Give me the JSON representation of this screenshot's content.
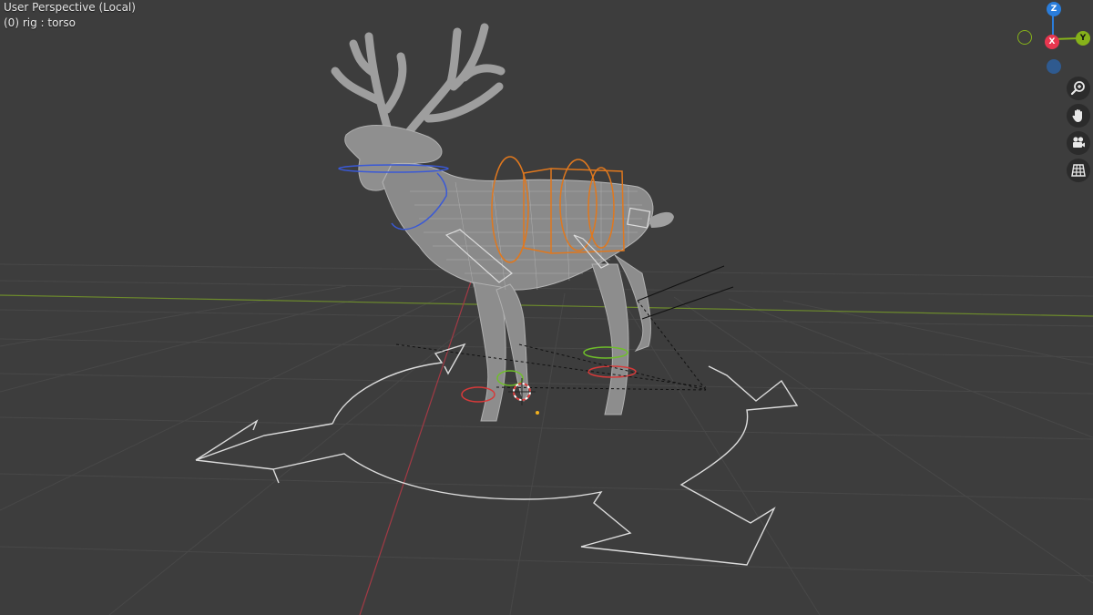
{
  "viewport": {
    "title": "User Perspective (Local)",
    "subtitle": "(0) rig : torso"
  },
  "gizmo": {
    "axes": {
      "z": "Z",
      "x": "X",
      "y": "Y"
    },
    "colors": {
      "x": "#e8364f",
      "y": "#86b21a",
      "z": "#2a7ddb",
      "neg_y": "#6b7a2e",
      "neg_z": "#2f5a8f"
    }
  },
  "nav_buttons": [
    "zoom-icon",
    "hand-pan-icon",
    "camera-icon",
    "grid-ortho-icon"
  ],
  "colors": {
    "background": "#3d3d3d",
    "grid": "#4a4a4a",
    "x_axis": "#9a2f3b",
    "y_axis": "#6a8a2a",
    "bone_orange": "#e0781e",
    "bone_blue": "#3a59d6"
  }
}
